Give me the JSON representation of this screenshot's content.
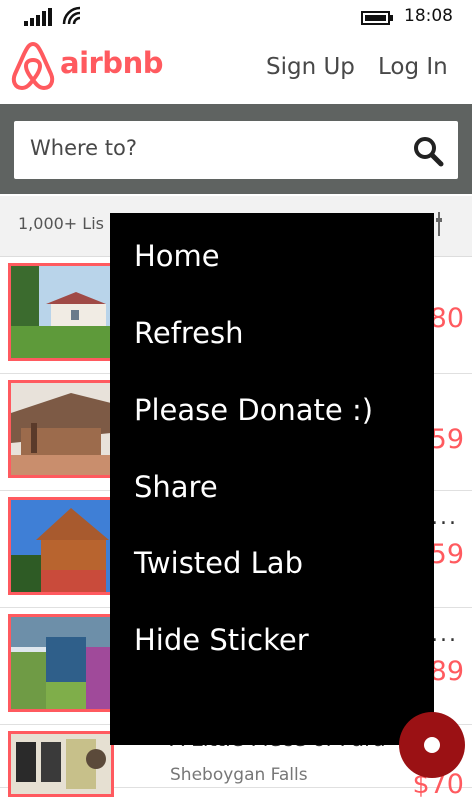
{
  "status": {
    "time": "18:08"
  },
  "header": {
    "brand": "airbnb",
    "signup": "Sign Up",
    "login": "Log In"
  },
  "search": {
    "placeholder": "Where to?"
  },
  "results": {
    "count_label": "1,000+ Lis"
  },
  "listings": [
    {
      "price": "80"
    },
    {
      "price": "59"
    },
    {
      "price": "59",
      "more": "..."
    },
    {
      "price": "89",
      "more": "..."
    },
    {
      "title": "A Little Piece of Para",
      "location": "Sheboygan Falls",
      "price": "$70"
    }
  ],
  "menu": {
    "items": [
      "Home",
      "Refresh",
      "Please Donate :)",
      "Share",
      "Twisted Lab",
      "Hide Sticker"
    ]
  },
  "colors": {
    "brand": "#ff5a5f",
    "fab": "#9b1114",
    "search_band": "#5f6361"
  }
}
